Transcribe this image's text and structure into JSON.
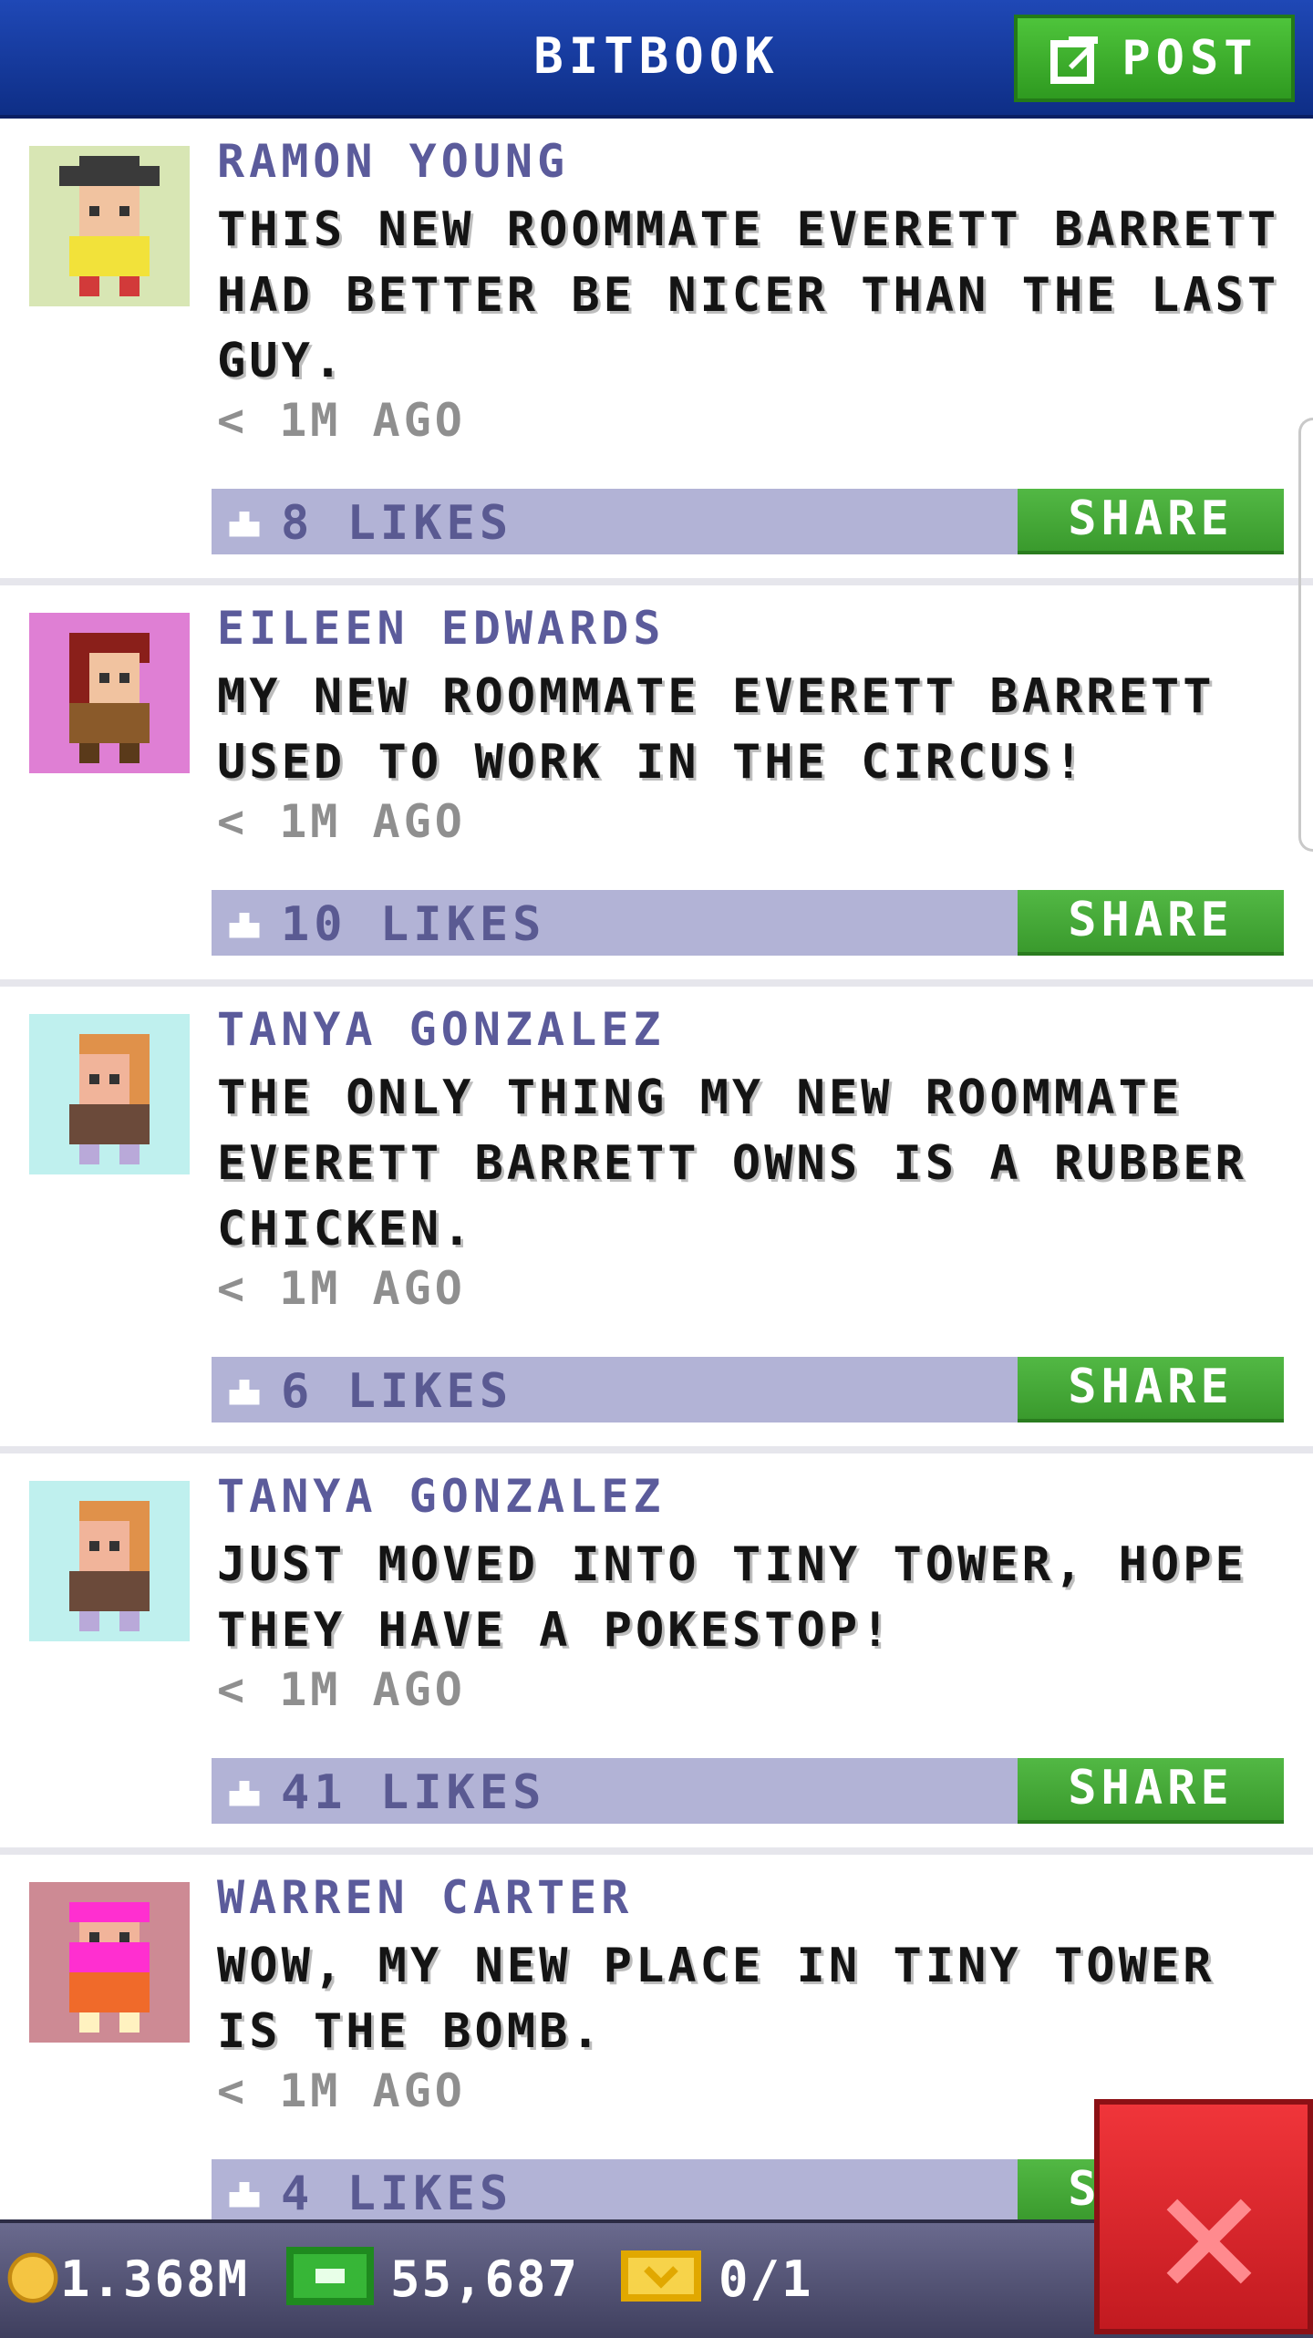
{
  "header": {
    "title": "BITBOOK",
    "post_label": "POST"
  },
  "posts": [
    {
      "author": "RAMON YOUNG",
      "message": "THIS NEW ROOMMATE EVERETT BARRETT HAD BETTER BE NICER THAN THE LAST GUY.",
      "time": "< 1M AGO",
      "likes": "8 LIKES",
      "share": "SHARE",
      "avatar_bg": "#d8e6b4"
    },
    {
      "author": "EILEEN EDWARDS",
      "message": "MY NEW ROOMMATE EVERETT BARRETT USED TO WORK IN THE CIRCUS!",
      "time": "< 1M AGO",
      "likes": "10 LIKES",
      "share": "SHARE",
      "avatar_bg": "#df7fd4"
    },
    {
      "author": "TANYA GONZALEZ",
      "message": "THE ONLY THING MY NEW ROOMMATE EVERETT BARRETT OWNS IS A RUBBER CHICKEN.",
      "time": "< 1M AGO",
      "likes": "6 LIKES",
      "share": "SHARE",
      "avatar_bg": "#bff0ee"
    },
    {
      "author": "TANYA GONZALEZ",
      "message": "JUST MOVED INTO TINY TOWER, HOPE THEY HAVE A POKESTOP!",
      "time": "< 1M AGO",
      "likes": "41 LIKES",
      "share": "SHARE",
      "avatar_bg": "#bff0ee"
    },
    {
      "author": "WARREN CARTER",
      "message": "WOW, MY NEW PLACE IN TINY TOWER IS THE BOMB.",
      "time": "< 1M AGO",
      "likes": "4 LIKES",
      "share": "SHARE",
      "avatar_bg": "#cd8a94"
    }
  ],
  "status": {
    "coins": "1.368M",
    "bux": "55,687",
    "tickets": "0/1"
  },
  "colors": {
    "header": "#1f48b6",
    "post_button": "#3fae2e",
    "like_bar": "#b2b3d6",
    "close_button": "#e0262c"
  }
}
